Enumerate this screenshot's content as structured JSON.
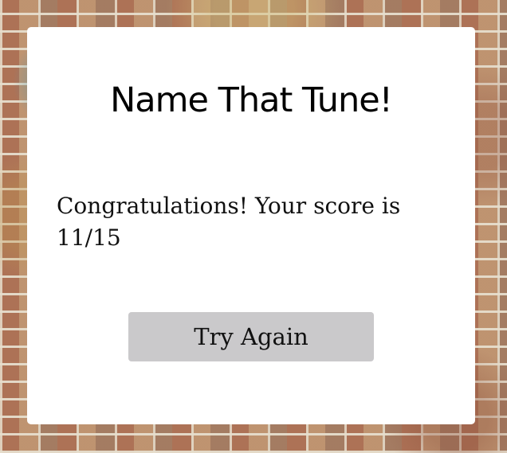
{
  "quiz": {
    "title": "Name That Tune!",
    "result_message": "Congratulations! Your score is 11/15",
    "try_again_label": "Try Again"
  },
  "colors": {
    "card_background": "#ffffff",
    "button_background": "#cac9cb",
    "text": "#000000"
  },
  "background": {
    "style": "brick-wall"
  }
}
